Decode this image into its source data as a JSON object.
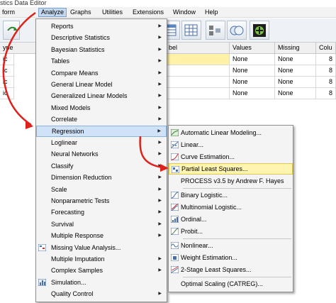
{
  "window": {
    "title": "stics Data Editor"
  },
  "menubar": {
    "items": [
      {
        "label": "form"
      },
      {
        "label": "Analyze"
      },
      {
        "label": "Graphs"
      },
      {
        "label": "Utilities"
      },
      {
        "label": "Extensions"
      },
      {
        "label": "Window"
      },
      {
        "label": "Help"
      }
    ]
  },
  "grid": {
    "headers": [
      "ype",
      "bel",
      "Values",
      "Missing",
      "Colu"
    ],
    "rows": [
      {
        "type": "ic",
        "values": "None",
        "missing": "None",
        "columns": "8"
      },
      {
        "type": "ic",
        "values": "None",
        "missing": "None",
        "columns": "8"
      },
      {
        "type": "ic",
        "values": "None",
        "missing": "None",
        "columns": "8"
      },
      {
        "type": "ic",
        "values": "None",
        "missing": "None",
        "columns": "8"
      }
    ]
  },
  "analyze_menu": {
    "items": [
      {
        "label": "Reports",
        "submenu": true
      },
      {
        "label": "Descriptive Statistics",
        "submenu": true
      },
      {
        "label": "Bayesian Statistics",
        "submenu": true
      },
      {
        "label": "Tables",
        "submenu": true
      },
      {
        "label": "Compare Means",
        "submenu": true
      },
      {
        "label": "General Linear Model",
        "submenu": true
      },
      {
        "label": "Generalized Linear Models",
        "submenu": true
      },
      {
        "label": "Mixed Models",
        "submenu": true
      },
      {
        "label": "Correlate",
        "submenu": true
      },
      {
        "label": "Regression",
        "submenu": true,
        "highlighted": true
      },
      {
        "label": "Loglinear",
        "submenu": true
      },
      {
        "label": "Neural Networks",
        "submenu": true
      },
      {
        "label": "Classify",
        "submenu": true
      },
      {
        "label": "Dimension Reduction",
        "submenu": true
      },
      {
        "label": "Scale",
        "submenu": true
      },
      {
        "label": "Nonparametric Tests",
        "submenu": true
      },
      {
        "label": "Forecasting",
        "submenu": true
      },
      {
        "label": "Survival",
        "submenu": true
      },
      {
        "label": "Multiple Response",
        "submenu": true
      },
      {
        "label": "Missing Value Analysis...",
        "icon": "missing-value-icon"
      },
      {
        "label": "Multiple Imputation",
        "submenu": true
      },
      {
        "label": "Complex Samples",
        "submenu": true
      },
      {
        "label": "Simulation...",
        "icon": "simulation-icon"
      },
      {
        "label": "Quality Control",
        "submenu": true
      }
    ]
  },
  "regression_submenu": {
    "items": [
      {
        "label": "Automatic Linear Modeling...",
        "icon": "automatic-linear-icon"
      },
      {
        "label": "Linear...",
        "icon": "linear-icon"
      },
      {
        "label": "Curve Estimation...",
        "icon": "curve-icon"
      },
      {
        "label": "Partial Least Squares...",
        "icon": "pls-icon",
        "highlighted": true
      },
      {
        "label": "PROCESS v3.5 by Andrew F. Hayes"
      },
      {
        "label": "Binary Logistic...",
        "icon": "binary-logistic-icon"
      },
      {
        "label": "Multinomial Logistic...",
        "icon": "multinomial-logistic-icon"
      },
      {
        "label": "Ordinal...",
        "icon": "ordinal-icon"
      },
      {
        "label": "Probit...",
        "icon": "probit-icon"
      },
      {
        "label": "Nonlinear...",
        "icon": "nonlinear-icon"
      },
      {
        "label": "Weight Estimation...",
        "icon": "weight-icon"
      },
      {
        "label": "2-Stage Least Squares...",
        "icon": "two-stage-icon"
      },
      {
        "label": "Optimal Scaling (CATREG)..."
      }
    ]
  },
  "colors": {
    "annotation_arrow": "#e0201a",
    "submenu_highlight": "#fff5b0",
    "menu_highlight": "#cfe2f8"
  }
}
